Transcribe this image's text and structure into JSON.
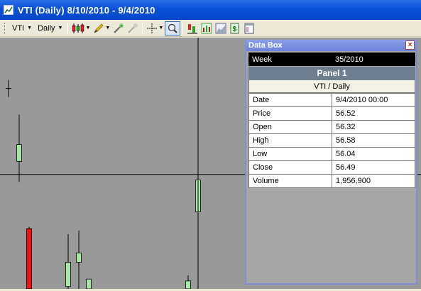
{
  "window": {
    "title": "VTI (Daily)  8/10/2010 - 9/4/2010",
    "icon": "chart-icon"
  },
  "toolbar": {
    "symbol": "VTI",
    "interval": "Daily",
    "icons": [
      "candlestick-icon",
      "pencil-icon",
      "add-indicator-icon",
      "remove-indicator-icon",
      "crosshair-icon",
      "zoom-icon",
      "compare-icon",
      "bar-chart-icon",
      "area-chart-icon",
      "dollar-icon",
      "panel-layout-icon"
    ]
  },
  "databox": {
    "title": "Data Box",
    "close_glyph": "×",
    "week_label": "Week",
    "week_value": "35/2010",
    "panel": "Panel 1",
    "symbol": "VTI / Daily",
    "rows": [
      {
        "label": "Date",
        "value": "9/4/2010 00:00"
      },
      {
        "label": "Price",
        "value": "56.52"
      },
      {
        "label": "Open",
        "value": "56.32"
      },
      {
        "label": "High",
        "value": "56.58"
      },
      {
        "label": "Low",
        "value": "56.04"
      },
      {
        "label": "Close",
        "value": "56.49"
      },
      {
        "label": "Volume",
        "value": "1,956,900"
      }
    ]
  },
  "chart_data": {
    "type": "candlestick",
    "background": "#999999",
    "up_color": "#a6e6a6",
    "down_color": "#ee1111",
    "crosshair_value": 56.52,
    "y_range": [
      55.9,
      57.1
    ],
    "candles": [
      {
        "tick": 56.98
      },
      {
        "open": 56.59,
        "high": 56.84,
        "low": 56.48,
        "close": 56.68,
        "dir": "up"
      },
      {
        "open": 56.23,
        "high": 56.24,
        "low": 55.9,
        "close": 55.9,
        "dir": "down"
      },
      {
        "open": 55.92,
        "high": 56.2,
        "low": 55.85,
        "close": 56.05,
        "dir": "up"
      },
      {
        "open": 56.05,
        "high": 56.22,
        "low": 55.9,
        "close": 56.1,
        "dir": "up"
      },
      {
        "open": 55.9,
        "high": 55.96,
        "low": 55.9,
        "close": 55.96,
        "dir": "up"
      },
      {
        "open": 55.9,
        "high": 55.98,
        "low": 55.9,
        "close": 55.95,
        "dir": "up"
      },
      {
        "open": 56.32,
        "high": 56.58,
        "low": 56.04,
        "close": 56.49,
        "dir": "up"
      }
    ]
  }
}
